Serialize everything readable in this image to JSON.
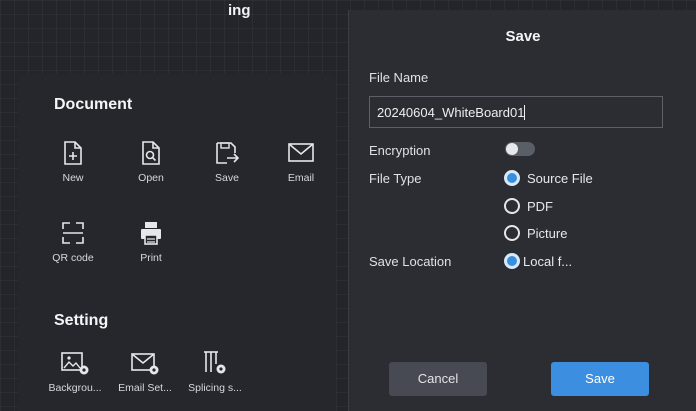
{
  "topbar": {
    "title": "ing"
  },
  "document": {
    "title": "Document",
    "tools": [
      {
        "label": "New",
        "icon": "new-file-icon"
      },
      {
        "label": "Open",
        "icon": "open-file-icon"
      },
      {
        "label": "Save",
        "icon": "save-file-icon"
      },
      {
        "label": "Email",
        "icon": "email-icon"
      },
      {
        "label": "QR code",
        "icon": "qr-code-icon"
      },
      {
        "label": "Print",
        "icon": "print-icon"
      }
    ]
  },
  "setting": {
    "title": "Setting",
    "tools": [
      {
        "label": "Backgrou...",
        "icon": "background-settings-icon"
      },
      {
        "label": "Email Set...",
        "icon": "email-settings-icon"
      },
      {
        "label": "Splicing s...",
        "icon": "splicing-settings-icon"
      }
    ]
  },
  "save_dialog": {
    "title": "Save",
    "file_name_label": "File Name",
    "file_name_value": "20240604_WhiteBoard01",
    "encryption_label": "Encryption",
    "encryption_on": false,
    "file_type_label": "File Type",
    "file_types": [
      {
        "label": "Source File",
        "selected": true
      },
      {
        "label": "PDF",
        "selected": false
      },
      {
        "label": "Picture",
        "selected": false
      }
    ],
    "save_location_label": "Save Location",
    "save_location_value": "Local f...",
    "cancel_label": "Cancel",
    "save_label": "Save",
    "accent_color": "#3c8ee0"
  }
}
